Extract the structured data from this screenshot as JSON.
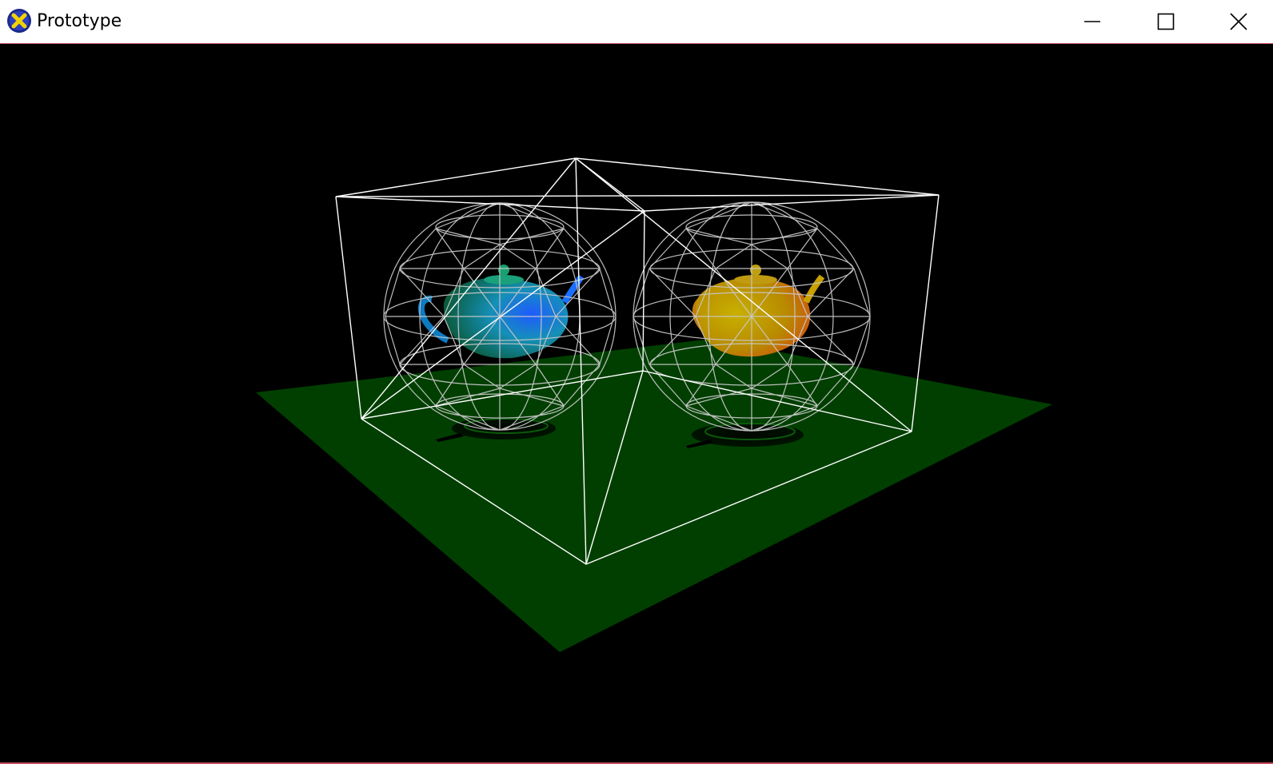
{
  "window": {
    "title": "Prototype",
    "app_icon": "x-window-icon",
    "controls": {
      "minimize_icon": "minimize-icon",
      "maximize_icon": "maximize-icon",
      "close_icon": "close-icon"
    }
  },
  "scene": {
    "background_color": "#000000",
    "floor_color": "#003d00",
    "wireframe_color": "#ffffff",
    "sphere_wire_color": "#c8c8c8",
    "left_teapot_colors": [
      "#1a6fff",
      "#0c8a5a"
    ],
    "right_teapot_colors": [
      "#c8a800",
      "#d04a10"
    ],
    "accent_border_color": "#c84b5a"
  }
}
